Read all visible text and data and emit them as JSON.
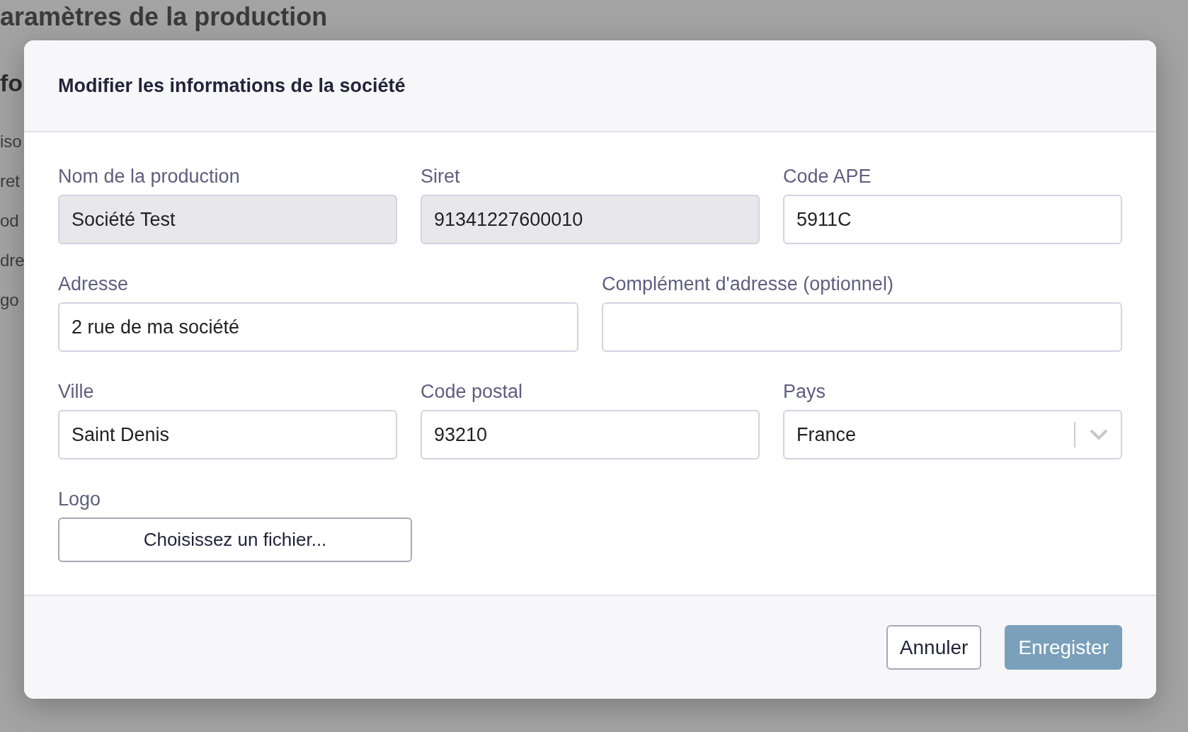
{
  "background": {
    "page_title": "aramètres de la production",
    "section_title": "fo",
    "items": [
      "iso",
      "ret",
      "od",
      "dre",
      "go"
    ]
  },
  "dialog": {
    "title": "Modifier les informations de la société",
    "field_lines": [
      [
        {
          "kind": "text",
          "label": "Nom de la production",
          "value": "Société Test",
          "disabled": true
        },
        {
          "kind": "text",
          "label": "Siret",
          "value": "91341227600010",
          "disabled": true
        },
        {
          "kind": "text",
          "label": "Code APE",
          "value": "5911C",
          "disabled": false
        }
      ],
      [
        {
          "kind": "text",
          "label": "Adresse",
          "value": "2 rue de ma société",
          "disabled": false
        },
        {
          "kind": "text",
          "label": "Complément d'adresse (optionnel)",
          "disabled": false
        }
      ],
      [
        {
          "kind": "text",
          "label": "Ville",
          "value": "Saint Denis",
          "disabled": false
        },
        {
          "kind": "text",
          "label": "Code postal",
          "value": "93210",
          "disabled": false
        },
        {
          "kind": "select",
          "label": "Pays",
          "value": "France",
          "disabled": false
        }
      ]
    ],
    "logo": {
      "label": "Logo",
      "button": "Choisissez un fichier..."
    },
    "buttons": [
      {
        "kind": "secondary",
        "label": "Annuler"
      },
      {
        "kind": "primary",
        "label": "Enregister"
      }
    ]
  }
}
